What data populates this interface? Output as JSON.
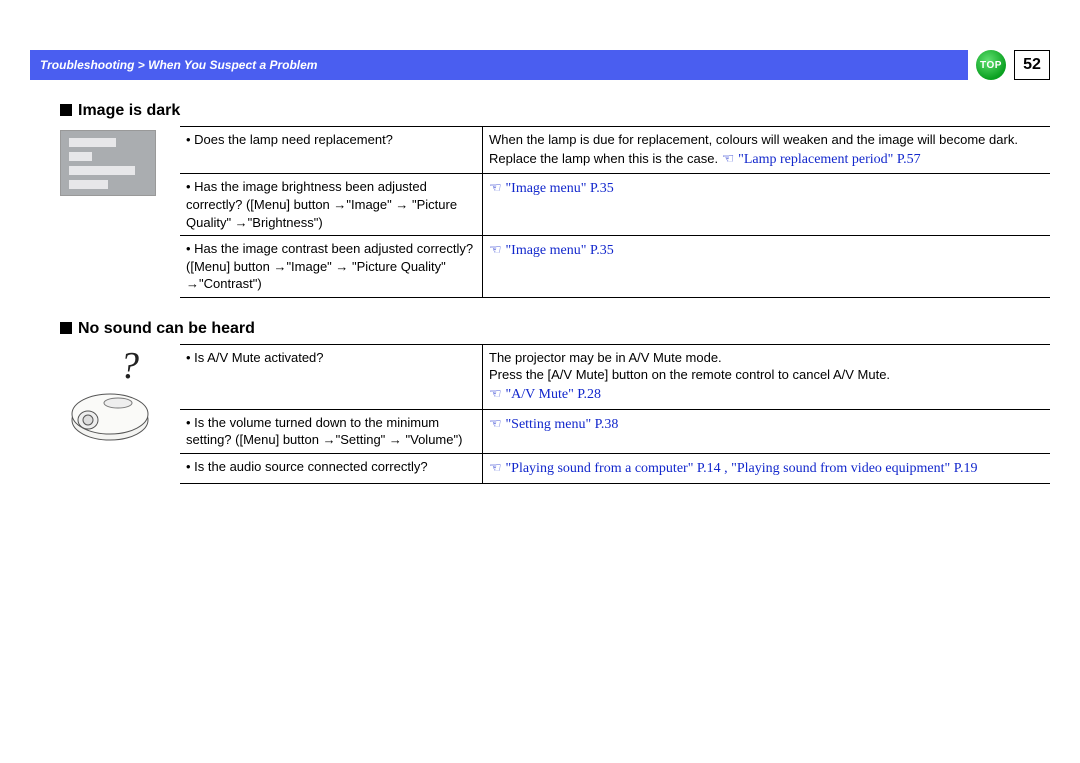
{
  "header": {
    "breadcrumb": "Troubleshooting > When You Suspect a Problem",
    "top_label": "TOP",
    "page_number": "52"
  },
  "section1": {
    "heading": "Image is dark",
    "rows": [
      {
        "q": "Does the lamp need replacement?",
        "a_plain": "When the lamp is due for replacement, colours will weaken and the image will become dark. Replace the lamp when this is the case. ",
        "a_link": "\"Lamp replacement period\" P.57"
      },
      {
        "q": "Has the image brightness been adjusted correctly? ([Menu] button →\"Image\" → \"Picture Quality\" →\"Brightness\")",
        "a_plain": "",
        "a_link": "\"Image menu\" P.35"
      },
      {
        "q": "Has the image contrast been adjusted correctly? ([Menu] button →\"Image\" → \"Picture Quality\" →\"Contrast\")",
        "a_plain": "",
        "a_link": "\"Image menu\" P.35"
      }
    ]
  },
  "section2": {
    "heading": "No sound can be heard",
    "rows": [
      {
        "q": "Is A/V Mute activated?",
        "a_plain_1": "The projector may be in A/V Mute mode.",
        "a_plain_2": "Press the [A/V Mute] button on the remote control to cancel A/V Mute.",
        "a_link": "\"A/V Mute\" P.28"
      },
      {
        "q": "Is the volume turned down to the minimum setting? ([Menu] button →\"Setting\" → \"Volume\")",
        "a_plain": "",
        "a_link": "\"Setting menu\" P.38"
      },
      {
        "q": "Is the audio source connected correctly?",
        "a_plain": "",
        "a_link": "\"Playing sound from a computer\" P.14 , \"Playing sound from video equipment\" P.19"
      }
    ]
  }
}
